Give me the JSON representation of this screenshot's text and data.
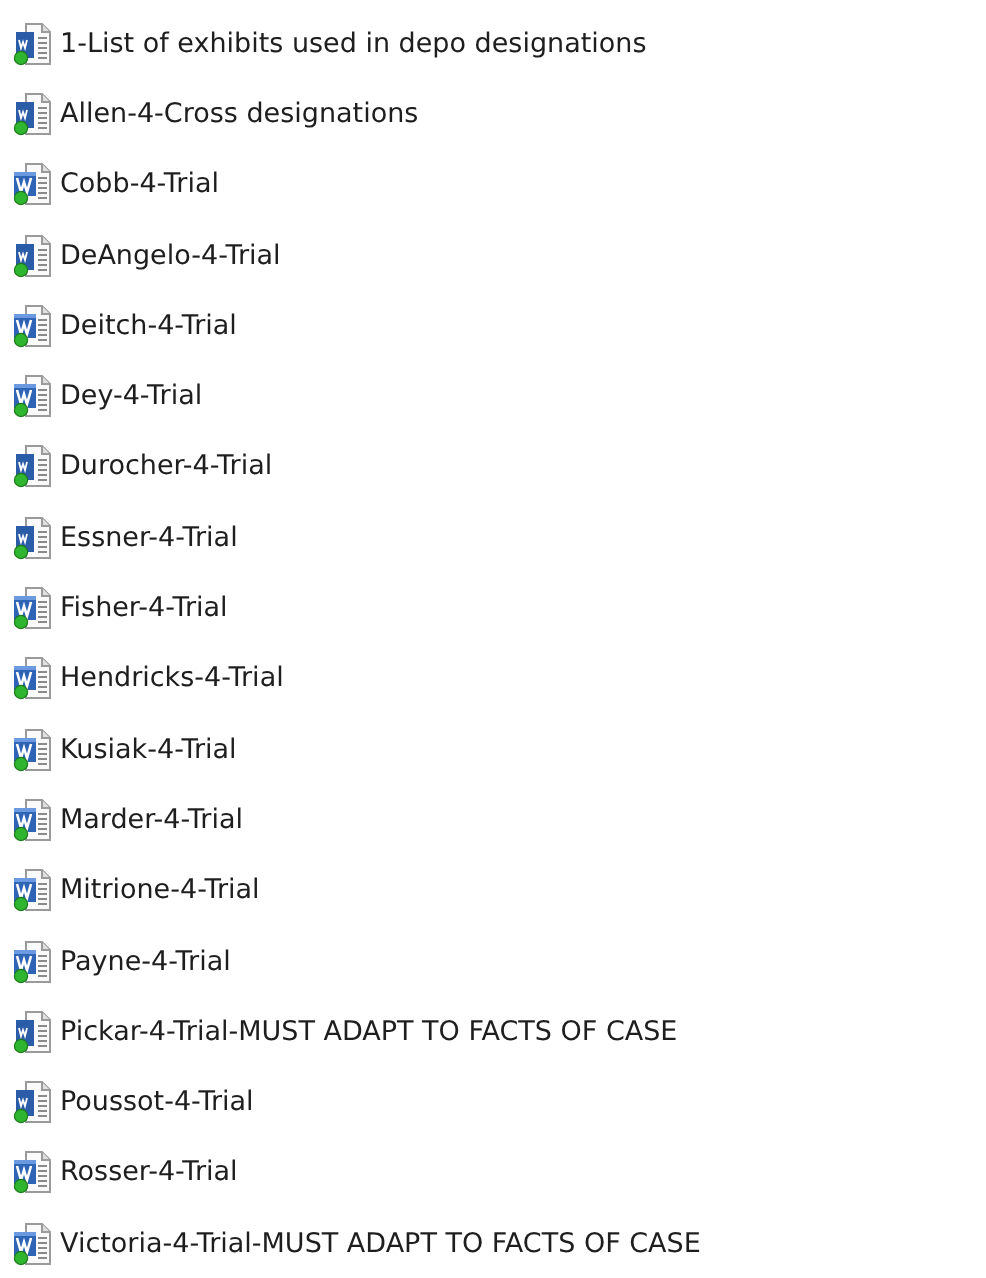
{
  "files": [
    {
      "name": "1-List of exhibits used in depo designations",
      "kind": "docx"
    },
    {
      "name": "Allen-4-Cross designations",
      "kind": "docx"
    },
    {
      "name": "Cobb-4-Trial",
      "kind": "doc"
    },
    {
      "name": "DeAngelo-4-Trial",
      "kind": "docx"
    },
    {
      "name": "Deitch-4-Trial",
      "kind": "doc"
    },
    {
      "name": "Dey-4-Trial",
      "kind": "doc"
    },
    {
      "name": "Durocher-4-Trial",
      "kind": "docx"
    },
    {
      "name": "Essner-4-Trial",
      "kind": "docx"
    },
    {
      "name": "Fisher-4-Trial",
      "kind": "doc"
    },
    {
      "name": "Hendricks-4-Trial",
      "kind": "doc"
    },
    {
      "name": "Kusiak-4-Trial",
      "kind": "doc"
    },
    {
      "name": "Marder-4-Trial",
      "kind": "doc"
    },
    {
      "name": "Mitrione-4-Trial",
      "kind": "doc"
    },
    {
      "name": "Payne-4-Trial",
      "kind": "doc"
    },
    {
      "name": "Pickar-4-Trial-MUST ADAPT TO FACTS OF CASE",
      "kind": "docx"
    },
    {
      "name": "Poussot-4-Trial",
      "kind": "docx"
    },
    {
      "name": "Rosser-4-Trial",
      "kind": "doc"
    },
    {
      "name": "Victoria-4-Trial-MUST ADAPT TO FACTS OF CASE",
      "kind": "doc"
    }
  ]
}
